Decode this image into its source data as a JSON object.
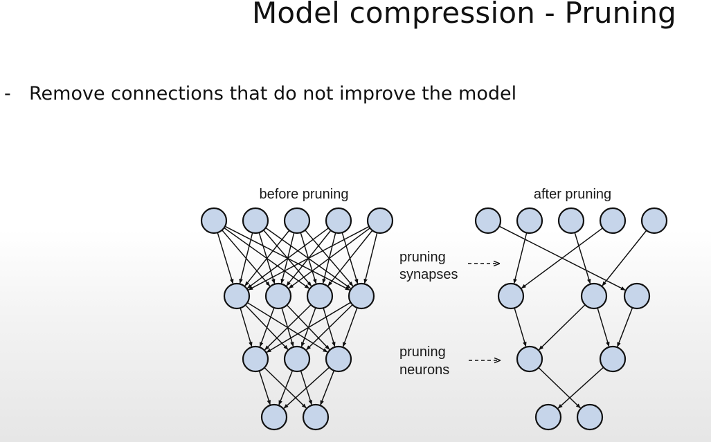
{
  "slide": {
    "title": "Model compression - Pruning",
    "bullets": [
      {
        "marker": "-",
        "text": "Remove connections that do not improve the model"
      }
    ]
  },
  "diagram": {
    "before_label": "before pruning",
    "after_label": "after pruning",
    "annotations": [
      {
        "lines": [
          "pruning",
          "synapses"
        ]
      },
      {
        "lines": [
          "pruning",
          "neurons"
        ]
      }
    ],
    "neuron_fill": "#c6d5ea",
    "edge_color": "#111111"
  }
}
